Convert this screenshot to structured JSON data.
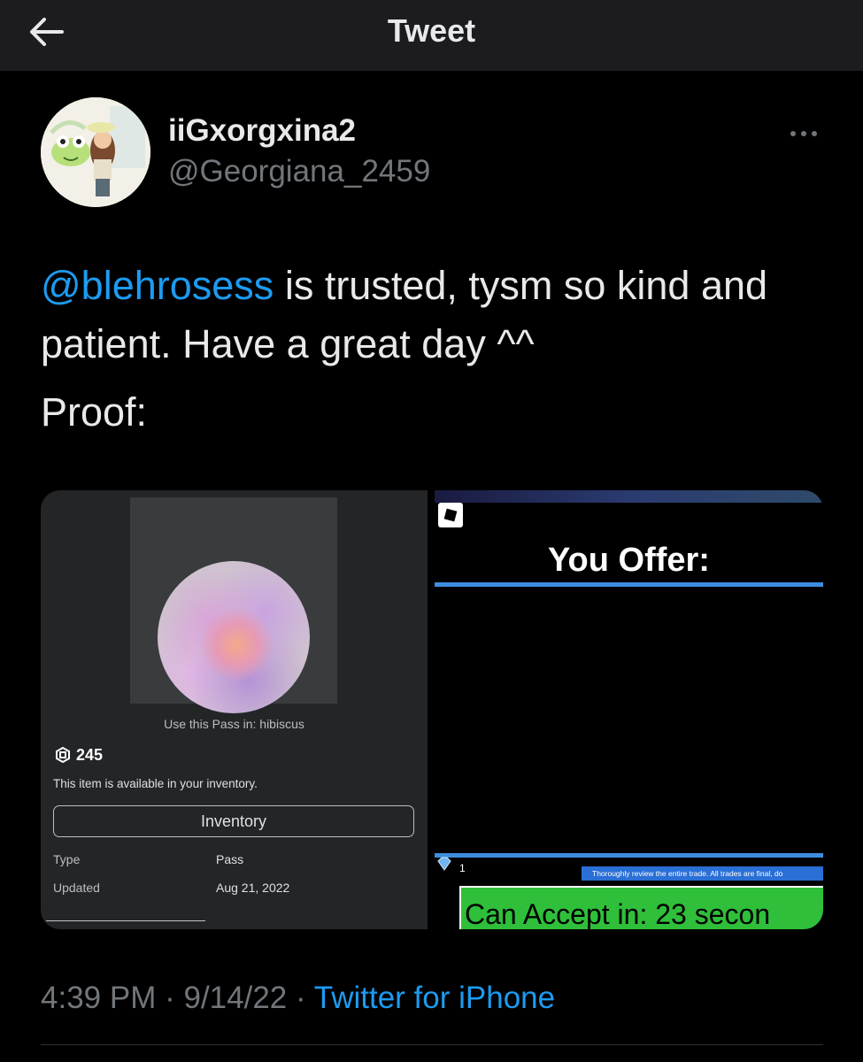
{
  "header": {
    "title": "Tweet",
    "back_icon": "arrow-left-icon"
  },
  "author": {
    "display_name": "iiGxorgxina2",
    "handle": "@Georgiana_2459"
  },
  "tweet": {
    "mention": "@blehrosess",
    "text_after_mention": " is trusted, tysm so kind and patient. Have a great day ^^",
    "proof_line": "Proof:"
  },
  "media_left": {
    "pass_text": "Use this Pass in: hibiscus",
    "price": "245",
    "availability": "This item is available in your inventory.",
    "inventory_button": "Inventory",
    "type_label": "Type",
    "type_value": "Pass",
    "updated_label": "Updated",
    "updated_value": "Aug 21, 2022"
  },
  "media_right": {
    "offer_title": "You Offer:",
    "gem_count": "1",
    "warning": "Thoroughly review the entire trade. All trades are final, do",
    "accept_text": "Can Accept in: 23 secon"
  },
  "footer": {
    "time": "4:39 PM",
    "separator": "·",
    "date": "9/14/22",
    "source": "Twitter for iPhone"
  },
  "colors": {
    "link": "#1d9bf0",
    "muted": "#71767b",
    "accept_green": "#2fbf3a",
    "trade_blue": "#3d8ee0"
  }
}
